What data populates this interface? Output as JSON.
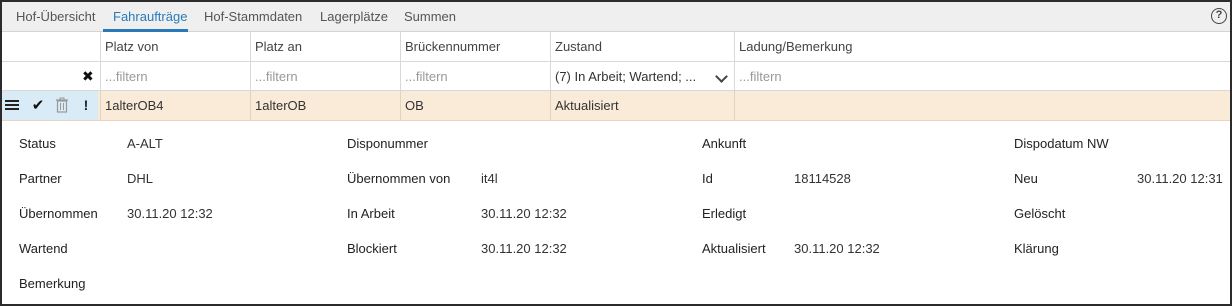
{
  "tabs": [
    "Hof-Übersicht",
    "Fahraufträge",
    "Hof-Stammdaten",
    "Lagerplätze",
    "Summen"
  ],
  "help_label": "?",
  "columns": [
    "Platz von",
    "Platz an",
    "Brückennummer",
    "Zustand",
    "Ladung/Bemerkung"
  ],
  "filters": {
    "placeholder": "...filtern",
    "zustand_value": "(7) In Arbeit; Wartend; ..."
  },
  "row": {
    "platz_von": "1alterOB4",
    "platz_an": "1alterOB",
    "brueckennummer": "OB",
    "zustand": "Aktualisiert",
    "ladung": ""
  },
  "details": {
    "status_label": "Status",
    "status_value": "A-ALT",
    "partner_label": "Partner",
    "partner_value": "DHL",
    "uebernommen_label": "Übernommen",
    "uebernommen_value": "30.11.20 12:32",
    "wartend_label": "Wartend",
    "wartend_value": "",
    "bemerkung_label": "Bemerkung",
    "bemerkung_value": "",
    "disponummer_label": "Disponummer",
    "disponummer_value": "",
    "uebernommen_von_label": "Übernommen von",
    "uebernommen_von_value": "it4l",
    "in_arbeit_label": "In Arbeit",
    "in_arbeit_value": "30.11.20 12:32",
    "blockiert_label": "Blockiert",
    "blockiert_value": "30.11.20 12:32",
    "ankunft_label": "Ankunft",
    "ankunft_value": "",
    "id_label": "Id",
    "id_value": "18114528",
    "erledigt_label": "Erledigt",
    "erledigt_value": "",
    "aktualisiert_label": "Aktualisiert",
    "aktualisiert_value": "30.11.20 12:32",
    "dispodatum_label": "Dispodatum NW",
    "dispodatum_value": "",
    "neu_label": "Neu",
    "neu_value": "30.11.20 12:31",
    "geloescht_label": "Gelöscht",
    "geloescht_value": "",
    "klaerung_label": "Klärung",
    "klaerung_value": ""
  },
  "icons": {
    "help": "help-icon",
    "clear_filter": "close-icon",
    "details": "list-icon",
    "confirm": "check-icon",
    "delete": "trash-icon",
    "priority": "exclamation-icon"
  },
  "colors": {
    "accent": "#2a7ab9",
    "selected_row": "#faebd9",
    "action_highlight": "#d9ebf7"
  }
}
